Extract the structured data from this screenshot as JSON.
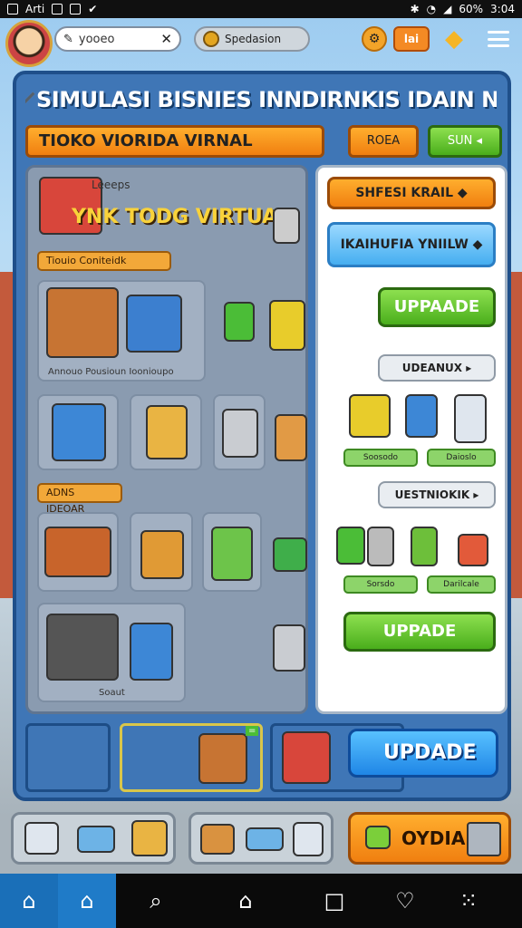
{
  "status_bar": {
    "carrier": "Arti",
    "battery": "60%",
    "time": "3:04"
  },
  "top": {
    "search_value": "yooeo",
    "currency_label": "Spedasion",
    "level": "lai"
  },
  "panel": {
    "title": "SIMULASI BISNIES INNDIRNKIS IDAIN NHANAI",
    "shop_name": "TIOKO VIORIDA VIRNAL",
    "btn_orange": "ROEA",
    "btn_green": "SUN",
    "left": {
      "small_label": "Leeeps",
      "banner": "YNK TODG VIRTUAL",
      "tag1": "Tiouio Coniteidk",
      "row1_caption": "Annouo Pousioun Ioonioupo",
      "section2": "ADNS IDEOAR",
      "bottom_caption": "Soaut"
    },
    "right": {
      "btn1": "SHFESI KRAIL",
      "btn2": "IKAIHUFIA YNIILW",
      "btn3": "UPPAADE",
      "sec1": "UDEANUX",
      "row1": [
        "Soosodo",
        "Daioslo"
      ],
      "sec2": "UESTNIOKIK",
      "row2": [
        "Sorsdo",
        "Darilcale"
      ],
      "btn4": "UPPADE"
    },
    "bottom": {
      "upgrade": "UPDADE",
      "flag": "="
    }
  },
  "tray": {
    "action": "OYDIAN"
  },
  "colors": {
    "panel": "#3f76b6",
    "orange": "#f07f10",
    "green": "#4aae1c",
    "blue": "#1f86e6"
  }
}
